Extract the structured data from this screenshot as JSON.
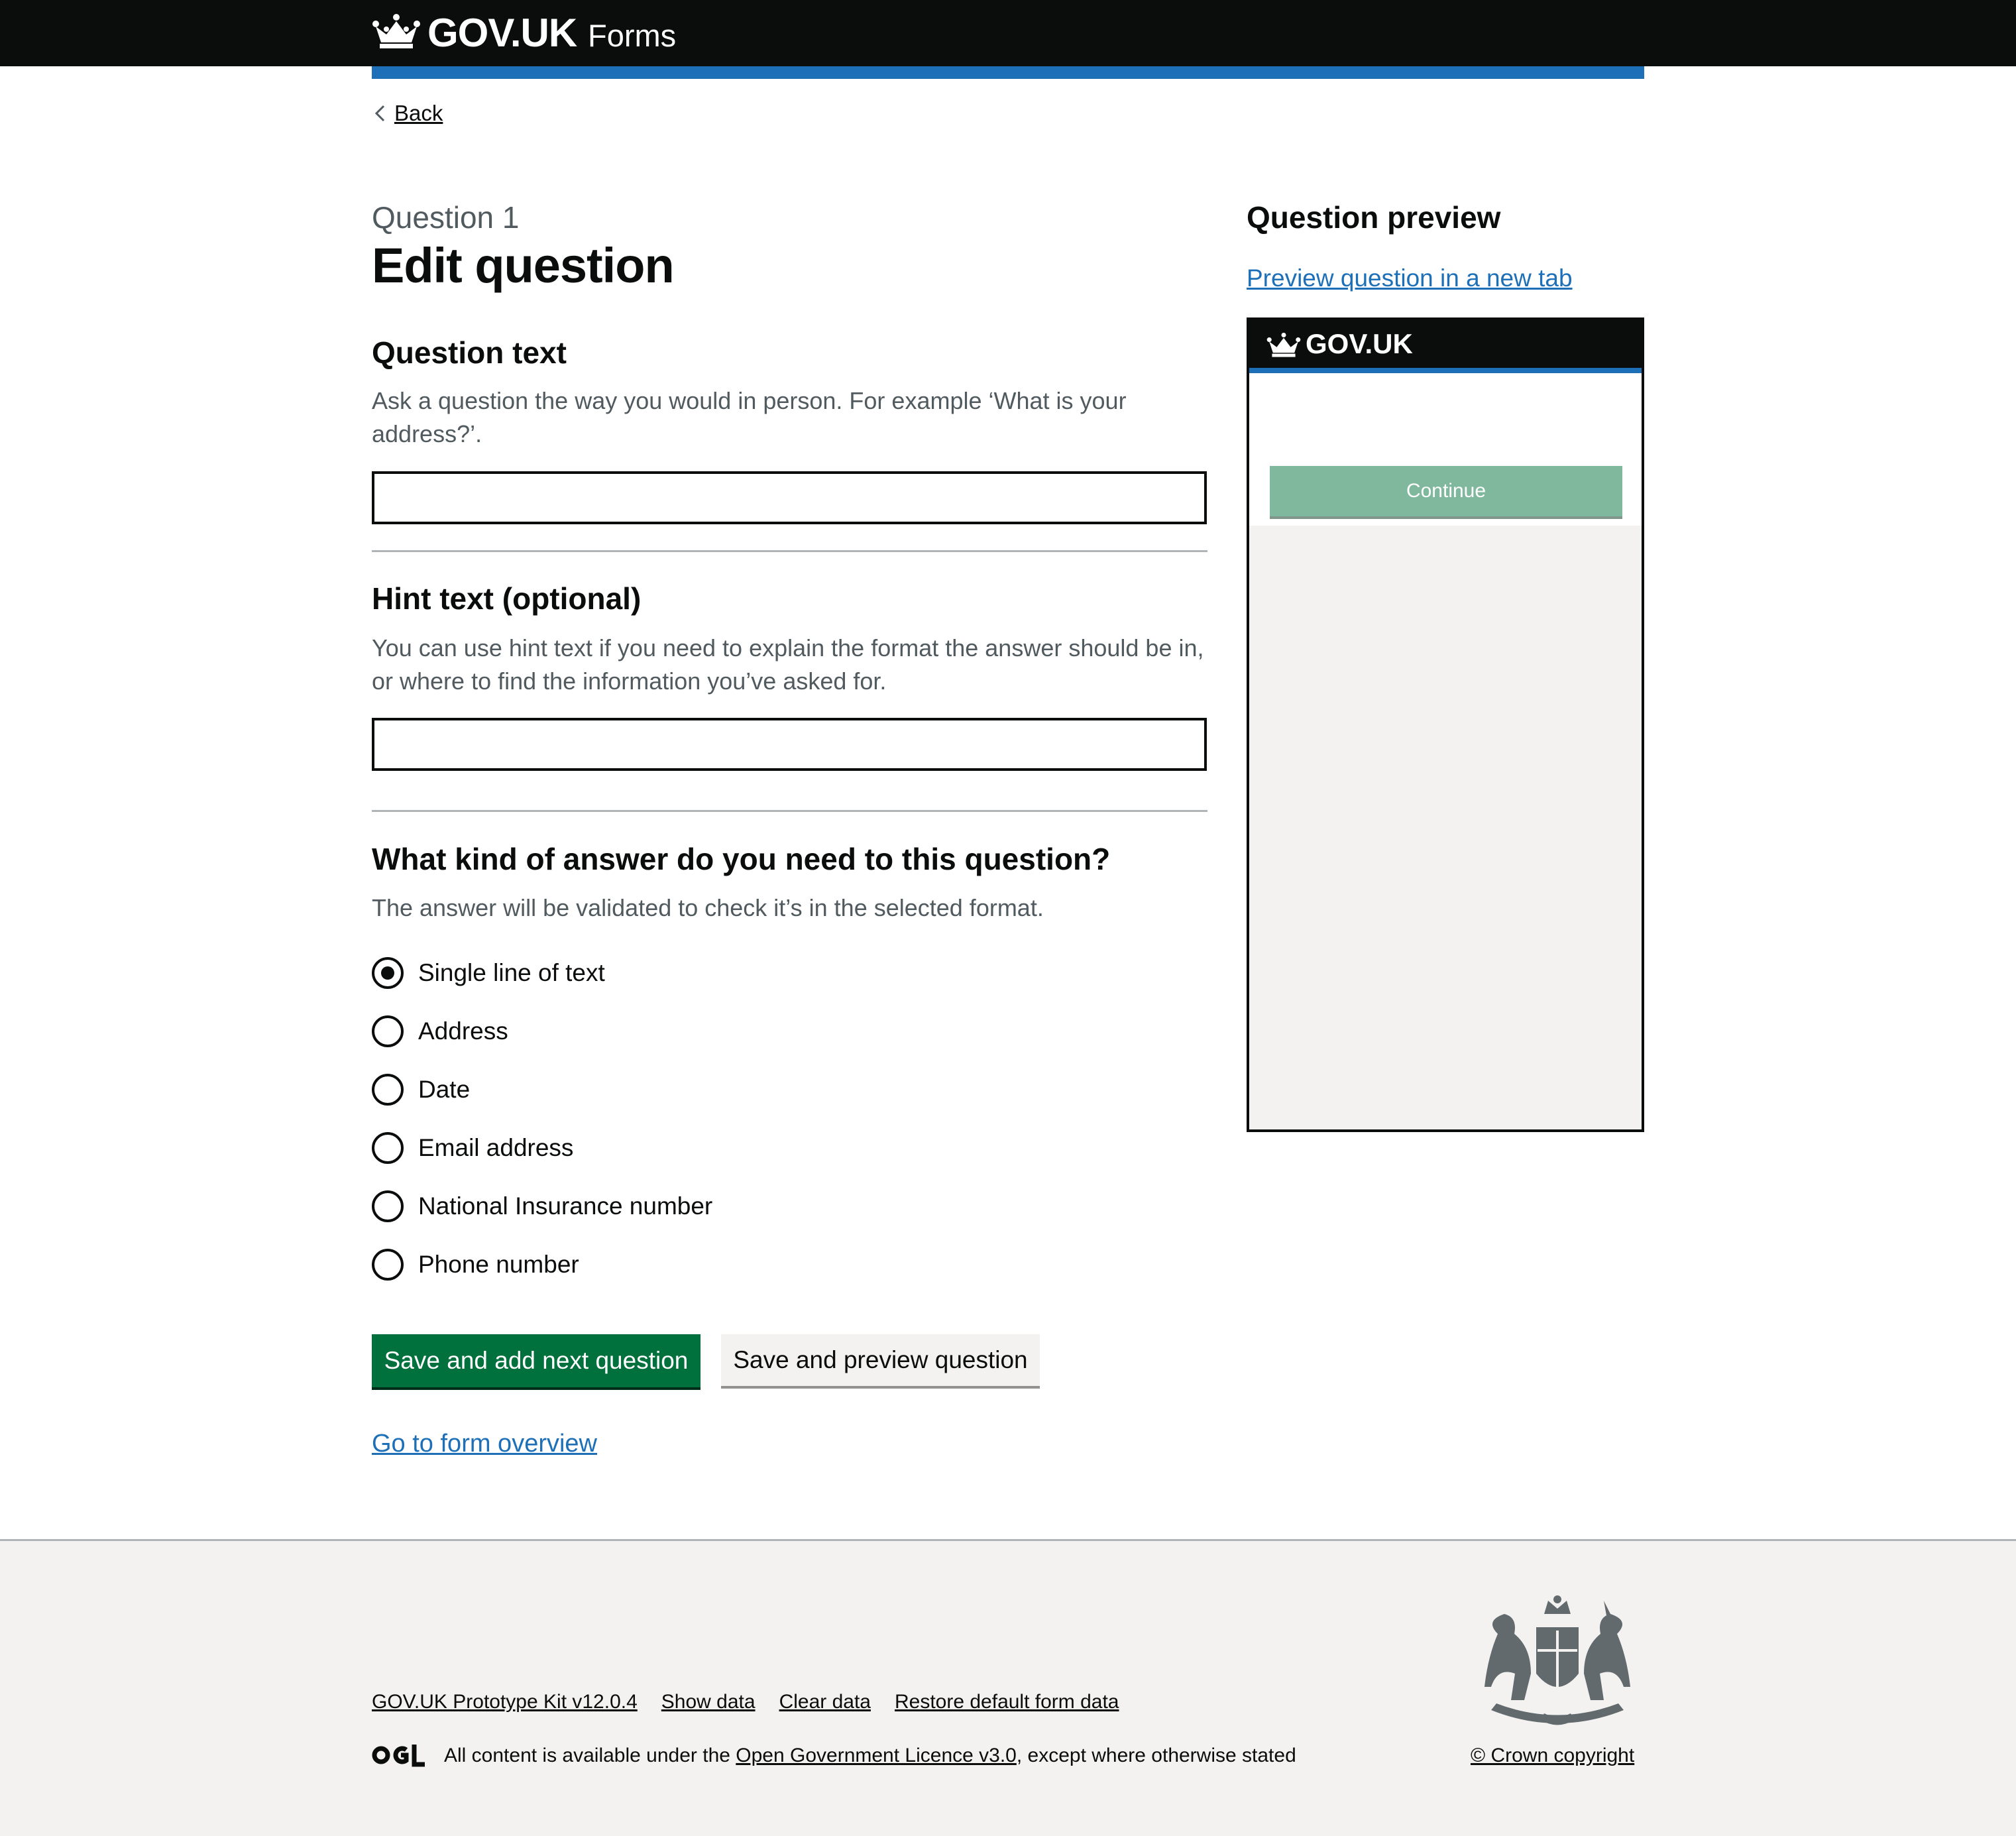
{
  "header": {
    "logo": "GOV.UK",
    "service_name": "Forms"
  },
  "nav": {
    "back": "Back"
  },
  "page": {
    "caption": "Question 1",
    "title": "Edit question"
  },
  "question_text": {
    "label": "Question text",
    "hint": "Ask a question the way you would in person. For example ‘What is your address?’.",
    "value": ""
  },
  "hint_text": {
    "label": "Hint text (optional)",
    "hint": "You can use hint text if you need to explain the format the answer should be in, or where to find the information you’ve asked for.",
    "value": ""
  },
  "answer_type": {
    "legend": "What kind of answer do you need to this question?",
    "hint": "The answer will be validated to check it’s in the selected format.",
    "options": [
      {
        "label": "Single line of text",
        "selected": true
      },
      {
        "label": "Address",
        "selected": false
      },
      {
        "label": "Date",
        "selected": false
      },
      {
        "label": "Email address",
        "selected": false
      },
      {
        "label": "National Insurance number",
        "selected": false
      },
      {
        "label": "Phone number",
        "selected": false
      }
    ]
  },
  "actions": {
    "primary": "Save and add next question",
    "secondary": "Save and preview question",
    "overview_link": "Go to form overview"
  },
  "preview": {
    "title": "Question preview",
    "link": "Preview question in a new tab",
    "logo": "GOV.UK",
    "button": "Continue"
  },
  "footer": {
    "links": [
      "GOV.UK Prototype Kit v12.0.4",
      "Show data",
      "Clear data",
      "Restore default form data"
    ],
    "licence_prefix": "All content is available under the ",
    "licence_link": "Open Government Licence v3.0",
    "licence_suffix": ", except where otherwise stated",
    "copyright": "© Crown copyright"
  },
  "colors": {
    "header_bg": "#0b0c0c",
    "accent_blue": "#1d70b8",
    "primary_button": "#00703c",
    "secondary_button": "#f3f2f1",
    "preview_button": "#80b89e",
    "footer_bg": "#f3f2f1"
  }
}
